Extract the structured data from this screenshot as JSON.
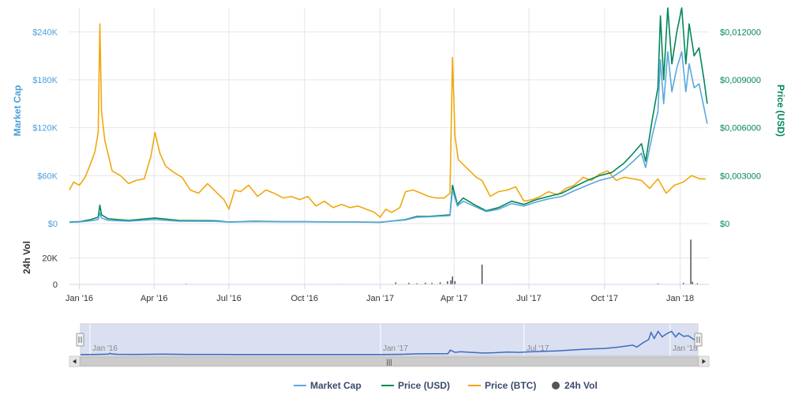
{
  "chart_data": {
    "type": "line",
    "colors": {
      "market_cap": "#5aa8dd",
      "price_usd": "#00875a",
      "price_btc": "#f2a70c",
      "volume": "#444444",
      "navigator_fill": "#cdd5ec",
      "navigator_line": "#3c6bbf"
    },
    "y_left": {
      "label": "Market Cap",
      "range": [
        0,
        270000
      ],
      "ticks": [
        {
          "v": 0,
          "label": "$0"
        },
        {
          "v": 60000,
          "label": "$60K"
        },
        {
          "v": 120000,
          "label": "$120K"
        },
        {
          "v": 180000,
          "label": "$180K"
        },
        {
          "v": 240000,
          "label": "$240K"
        }
      ]
    },
    "y_right": {
      "label": "Price (USD)",
      "range": [
        0,
        0.0135
      ],
      "ticks": [
        {
          "v": 0,
          "label": "$0"
        },
        {
          "v": 0.003,
          "label": "$0,003000"
        },
        {
          "v": 0.006,
          "label": "$0,006000"
        },
        {
          "v": 0.009,
          "label": "$0,009000"
        },
        {
          "v": 0.012,
          "label": "$0,012000"
        }
      ]
    },
    "y_vol": {
      "label": "24h Vol",
      "range": [
        0,
        36000
      ],
      "ticks": [
        {
          "v": 0,
          "label": "0"
        },
        {
          "v": 20000,
          "label": "20K"
        }
      ]
    },
    "x_range": [
      "2015-12-20",
      "2018-02-05"
    ],
    "x_ticks": [
      {
        "date": "2016-01-01",
        "label": "Jan '16"
      },
      {
        "date": "2016-04-01",
        "label": "Apr '16"
      },
      {
        "date": "2016-07-01",
        "label": "Jul '16"
      },
      {
        "date": "2016-10-01",
        "label": "Oct '16"
      },
      {
        "date": "2017-01-01",
        "label": "Jan '17"
      },
      {
        "date": "2017-04-01",
        "label": "Apr '17"
      },
      {
        "date": "2017-07-01",
        "label": "Jul '17"
      },
      {
        "date": "2017-10-01",
        "label": "Oct '17"
      },
      {
        "date": "2018-01-01",
        "label": "Jan '18"
      }
    ],
    "navigator_ticks": [
      {
        "date": "2016-01-01",
        "label": "Jan '16"
      },
      {
        "date": "2017-01-01",
        "label": "Jan '17"
      },
      {
        "date": "2017-07-01",
        "label": "Jul '17"
      },
      {
        "date": "2018-01-01",
        "label": "Jan '18"
      }
    ],
    "series": [
      {
        "key": "price_btc",
        "name": "Price (BTC)",
        "axis": "right",
        "points": [
          [
            "2015-12-20",
            0.0021
          ],
          [
            "2015-12-25",
            0.0026
          ],
          [
            "2016-01-01",
            0.0024
          ],
          [
            "2016-01-08",
            0.0029
          ],
          [
            "2016-01-15",
            0.0038
          ],
          [
            "2016-01-20",
            0.0045
          ],
          [
            "2016-01-24",
            0.0057
          ],
          [
            "2016-01-26",
            0.0125
          ],
          [
            "2016-01-28",
            0.007
          ],
          [
            "2016-02-01",
            0.0052
          ],
          [
            "2016-02-10",
            0.0033
          ],
          [
            "2016-02-20",
            0.003
          ],
          [
            "2016-03-01",
            0.0025
          ],
          [
            "2016-03-10",
            0.0027
          ],
          [
            "2016-03-20",
            0.0028
          ],
          [
            "2016-03-28",
            0.0042
          ],
          [
            "2016-04-02",
            0.0057
          ],
          [
            "2016-04-08",
            0.0044
          ],
          [
            "2016-04-15",
            0.0036
          ],
          [
            "2016-04-25",
            0.0032
          ],
          [
            "2016-05-05",
            0.0029
          ],
          [
            "2016-05-15",
            0.0021
          ],
          [
            "2016-05-25",
            0.0019
          ],
          [
            "2016-06-05",
            0.0025
          ],
          [
            "2016-06-15",
            0.002
          ],
          [
            "2016-06-25",
            0.0015
          ],
          [
            "2016-07-01",
            0.0009
          ],
          [
            "2016-07-08",
            0.0021
          ],
          [
            "2016-07-15",
            0.002
          ],
          [
            "2016-07-25",
            0.0024
          ],
          [
            "2016-08-05",
            0.0017
          ],
          [
            "2016-08-15",
            0.0021
          ],
          [
            "2016-08-25",
            0.0019
          ],
          [
            "2016-09-05",
            0.0016
          ],
          [
            "2016-09-15",
            0.0017
          ],
          [
            "2016-09-25",
            0.0015
          ],
          [
            "2016-10-05",
            0.0017
          ],
          [
            "2016-10-15",
            0.0011
          ],
          [
            "2016-10-25",
            0.0014
          ],
          [
            "2016-11-05",
            0.001
          ],
          [
            "2016-11-15",
            0.0012
          ],
          [
            "2016-11-25",
            0.001
          ],
          [
            "2016-12-05",
            0.0011
          ],
          [
            "2016-12-15",
            0.0009
          ],
          [
            "2016-12-25",
            0.0007
          ],
          [
            "2017-01-01",
            0.0004
          ],
          [
            "2017-01-08",
            0.0009
          ],
          [
            "2017-01-15",
            0.0007
          ],
          [
            "2017-01-25",
            0.001
          ],
          [
            "2017-02-01",
            0.002
          ],
          [
            "2017-02-10",
            0.0021
          ],
          [
            "2017-02-20",
            0.0019
          ],
          [
            "2017-03-01",
            0.0017
          ],
          [
            "2017-03-10",
            0.0016
          ],
          [
            "2017-03-20",
            0.0016
          ],
          [
            "2017-03-27",
            0.0019
          ],
          [
            "2017-03-30",
            0.0104
          ],
          [
            "2017-04-02",
            0.0055
          ],
          [
            "2017-04-06",
            0.004
          ],
          [
            "2017-04-12",
            0.0037
          ],
          [
            "2017-04-20",
            0.0033
          ],
          [
            "2017-04-28",
            0.0029
          ],
          [
            "2017-05-05",
            0.0027
          ],
          [
            "2017-05-15",
            0.0017
          ],
          [
            "2017-05-25",
            0.002
          ],
          [
            "2017-06-05",
            0.0021
          ],
          [
            "2017-06-15",
            0.0023
          ],
          [
            "2017-06-25",
            0.0014
          ],
          [
            "2017-07-05",
            0.0015
          ],
          [
            "2017-07-15",
            0.0017
          ],
          [
            "2017-07-25",
            0.002
          ],
          [
            "2017-08-05",
            0.0018
          ],
          [
            "2017-08-15",
            0.0022
          ],
          [
            "2017-08-25",
            0.0024
          ],
          [
            "2017-09-05",
            0.0029
          ],
          [
            "2017-09-15",
            0.0027
          ],
          [
            "2017-09-25",
            0.0031
          ],
          [
            "2017-10-05",
            0.0033
          ],
          [
            "2017-10-15",
            0.0027
          ],
          [
            "2017-10-25",
            0.0029
          ],
          [
            "2017-11-05",
            0.0028
          ],
          [
            "2017-11-15",
            0.0027
          ],
          [
            "2017-11-25",
            0.0022
          ],
          [
            "2017-12-05",
            0.0028
          ],
          [
            "2017-12-15",
            0.0019
          ],
          [
            "2017-12-25",
            0.0024
          ],
          [
            "2018-01-05",
            0.0026
          ],
          [
            "2018-01-15",
            0.003
          ],
          [
            "2018-01-25",
            0.0028
          ],
          [
            "2018-02-01",
            0.0028
          ]
        ]
      },
      {
        "key": "price_usd",
        "name": "Price (USD)",
        "axis": "right",
        "points": [
          [
            "2015-12-20",
            0.0001
          ],
          [
            "2016-01-01",
            0.00012
          ],
          [
            "2016-01-15",
            0.00025
          ],
          [
            "2016-01-24",
            0.0004
          ],
          [
            "2016-01-26",
            0.00115
          ],
          [
            "2016-01-28",
            0.00055
          ],
          [
            "2016-02-05",
            0.0003
          ],
          [
            "2016-03-01",
            0.0002
          ],
          [
            "2016-04-02",
            0.00035
          ],
          [
            "2016-05-01",
            0.0002
          ],
          [
            "2016-06-15",
            0.00018
          ],
          [
            "2016-07-01",
            0.0001
          ],
          [
            "2016-08-01",
            0.00015
          ],
          [
            "2016-09-01",
            0.00012
          ],
          [
            "2016-10-01",
            0.00012
          ],
          [
            "2016-11-01",
            0.0001
          ],
          [
            "2016-12-01",
            0.0001
          ],
          [
            "2017-01-01",
            8e-05
          ],
          [
            "2017-02-01",
            0.00025
          ],
          [
            "2017-02-15",
            0.00045
          ],
          [
            "2017-03-01",
            0.00045
          ],
          [
            "2017-03-27",
            0.00055
          ],
          [
            "2017-03-30",
            0.0024
          ],
          [
            "2017-04-05",
            0.0012
          ],
          [
            "2017-04-12",
            0.0016
          ],
          [
            "2017-04-25",
            0.0012
          ],
          [
            "2017-05-10",
            0.0008
          ],
          [
            "2017-05-25",
            0.001
          ],
          [
            "2017-06-10",
            0.0014
          ],
          [
            "2017-06-25",
            0.0012
          ],
          [
            "2017-07-10",
            0.0015
          ],
          [
            "2017-07-25",
            0.0017
          ],
          [
            "2017-08-10",
            0.0019
          ],
          [
            "2017-08-25",
            0.0023
          ],
          [
            "2017-09-10",
            0.0027
          ],
          [
            "2017-09-25",
            0.003
          ],
          [
            "2017-10-10",
            0.0032
          ],
          [
            "2017-10-25",
            0.0038
          ],
          [
            "2017-11-05",
            0.0044
          ],
          [
            "2017-11-15",
            0.005
          ],
          [
            "2017-11-20",
            0.0039
          ],
          [
            "2017-11-28",
            0.0065
          ],
          [
            "2017-12-05",
            0.0085
          ],
          [
            "2017-12-08",
            0.013
          ],
          [
            "2017-12-12",
            0.009
          ],
          [
            "2017-12-17",
            0.0135
          ],
          [
            "2017-12-22",
            0.01
          ],
          [
            "2017-12-28",
            0.012
          ],
          [
            "2018-01-03",
            0.0135
          ],
          [
            "2018-01-08",
            0.01
          ],
          [
            "2018-01-12",
            0.0125
          ],
          [
            "2018-01-18",
            0.0105
          ],
          [
            "2018-01-24",
            0.011
          ],
          [
            "2018-01-30",
            0.009
          ],
          [
            "2018-02-03",
            0.0075
          ]
        ]
      },
      {
        "key": "market_cap",
        "name": "Market Cap",
        "axis": "left",
        "points": [
          [
            "2015-12-20",
            1500
          ],
          [
            "2016-01-01",
            2000
          ],
          [
            "2016-01-15",
            3500
          ],
          [
            "2016-01-24",
            5000
          ],
          [
            "2016-01-26",
            13000
          ],
          [
            "2016-01-28",
            7000
          ],
          [
            "2016-02-05",
            4000
          ],
          [
            "2016-03-01",
            3000
          ],
          [
            "2016-04-02",
            5000
          ],
          [
            "2016-05-01",
            3000
          ],
          [
            "2016-06-15",
            2800
          ],
          [
            "2016-07-01",
            1800
          ],
          [
            "2016-08-01",
            2500
          ],
          [
            "2016-09-01",
            2200
          ],
          [
            "2016-10-01",
            2200
          ],
          [
            "2016-11-01",
            2000
          ],
          [
            "2016-12-01",
            2000
          ],
          [
            "2017-01-01",
            1800
          ],
          [
            "2017-02-01",
            4500
          ],
          [
            "2017-02-15",
            8000
          ],
          [
            "2017-03-01",
            8500
          ],
          [
            "2017-03-27",
            10000
          ],
          [
            "2017-03-30",
            42000
          ],
          [
            "2017-04-05",
            22000
          ],
          [
            "2017-04-12",
            28000
          ],
          [
            "2017-04-25",
            22000
          ],
          [
            "2017-05-10",
            15000
          ],
          [
            "2017-05-25",
            18000
          ],
          [
            "2017-06-10",
            25000
          ],
          [
            "2017-06-25",
            22000
          ],
          [
            "2017-07-10",
            27000
          ],
          [
            "2017-07-25",
            31000
          ],
          [
            "2017-08-10",
            34000
          ],
          [
            "2017-08-25",
            41000
          ],
          [
            "2017-09-10",
            48000
          ],
          [
            "2017-09-25",
            54000
          ],
          [
            "2017-10-10",
            58000
          ],
          [
            "2017-10-25",
            68000
          ],
          [
            "2017-11-05",
            78000
          ],
          [
            "2017-11-15",
            88000
          ],
          [
            "2017-11-20",
            70000
          ],
          [
            "2017-11-28",
            110000
          ],
          [
            "2017-12-05",
            140000
          ],
          [
            "2017-12-08",
            205000
          ],
          [
            "2017-12-12",
            150000
          ],
          [
            "2017-12-17",
            215000
          ],
          [
            "2017-12-22",
            165000
          ],
          [
            "2017-12-28",
            195000
          ],
          [
            "2018-01-03",
            215000
          ],
          [
            "2018-01-08",
            165000
          ],
          [
            "2018-01-12",
            200000
          ],
          [
            "2018-01-18",
            170000
          ],
          [
            "2018-01-24",
            175000
          ],
          [
            "2018-01-30",
            145000
          ],
          [
            "2018-02-03",
            125000
          ]
        ]
      }
    ],
    "volume": {
      "key": "volume",
      "name": "24h Vol",
      "points": [
        [
          "2016-04-05",
          300
        ],
        [
          "2016-05-10",
          500
        ],
        [
          "2016-08-20",
          300
        ],
        [
          "2016-11-15",
          400
        ],
        [
          "2017-01-20",
          1500
        ],
        [
          "2017-02-05",
          1200
        ],
        [
          "2017-02-15",
          900
        ],
        [
          "2017-02-25",
          1300
        ],
        [
          "2017-03-05",
          1100
        ],
        [
          "2017-03-15",
          1600
        ],
        [
          "2017-03-24",
          2400
        ],
        [
          "2017-03-28",
          3000
        ],
        [
          "2017-03-30",
          6000
        ],
        [
          "2017-04-02",
          2500
        ],
        [
          "2017-05-05",
          15000
        ],
        [
          "2017-06-20",
          400
        ],
        [
          "2017-08-10",
          300
        ],
        [
          "2017-12-05",
          800
        ],
        [
          "2018-01-05",
          1200
        ],
        [
          "2018-01-14",
          34000
        ],
        [
          "2018-01-16",
          2000
        ],
        [
          "2018-01-22",
          900
        ]
      ]
    },
    "legend": {
      "position": "bottom-center",
      "items": [
        {
          "key": "market_cap",
          "label": "Market Cap",
          "marker": "line"
        },
        {
          "key": "price_usd",
          "label": "Price (USD)",
          "marker": "line"
        },
        {
          "key": "price_btc",
          "label": "Price (BTC)",
          "marker": "line"
        },
        {
          "key": "volume",
          "label": "24h Vol",
          "marker": "dot"
        }
      ]
    },
    "grid": true,
    "navigator": {
      "selection": [
        "2015-12-20",
        "2018-02-05"
      ],
      "series_key": "market_cap"
    },
    "scrollbar": {
      "grip": "|||"
    }
  }
}
